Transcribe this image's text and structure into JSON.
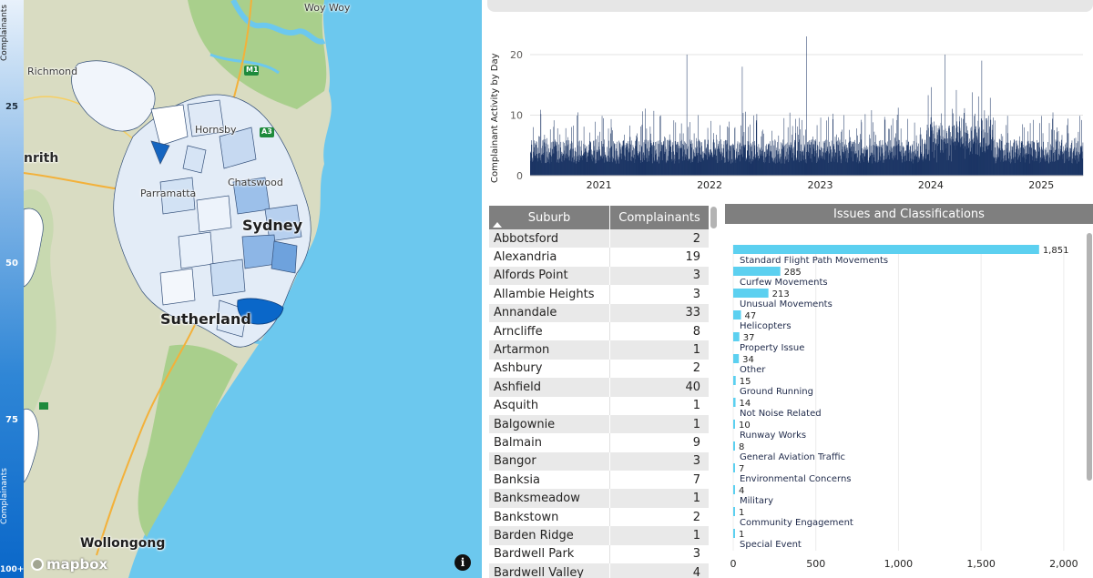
{
  "legend": {
    "title_top": "Complainants",
    "title_bottom": "Complainants",
    "ticks": [
      "25",
      "50",
      "75",
      "100+"
    ]
  },
  "map": {
    "labels": {
      "woy_woy": "Woy Woy",
      "richmond": "Richmond",
      "penrith": "nrith",
      "hornsby": "Hornsby",
      "parramatta": "Parramatta",
      "chatswood": "Chatswood",
      "sydney": "Sydney",
      "sutherland": "Sutherland",
      "wollongong": "Wollongong",
      "m1": "M1",
      "a3": "A3"
    },
    "attribution": "mapbox",
    "info_icon": "info-icon",
    "colors": {
      "water": "#6cc8ee",
      "land": "#d9dcc2",
      "bush": "#a9cf8c",
      "suburb_high": "#0a67c9"
    }
  },
  "activity_chart": {
    "ylabel": "Complainant Activity by Day"
  },
  "suburb_table": {
    "columns": [
      "Suburb",
      "Complainants"
    ],
    "sort": "ascending",
    "rows": [
      {
        "suburb": "Abbotsford",
        "count": "2"
      },
      {
        "suburb": "Alexandria",
        "count": "19"
      },
      {
        "suburb": "Alfords Point",
        "count": "3"
      },
      {
        "suburb": "Allambie Heights",
        "count": "3"
      },
      {
        "suburb": "Annandale",
        "count": "33"
      },
      {
        "suburb": "Arncliffe",
        "count": "8"
      },
      {
        "suburb": "Artarmon",
        "count": "1"
      },
      {
        "suburb": "Ashbury",
        "count": "2"
      },
      {
        "suburb": "Ashfield",
        "count": "40"
      },
      {
        "suburb": "Asquith",
        "count": "1"
      },
      {
        "suburb": "Balgownie",
        "count": "1"
      },
      {
        "suburb": "Balmain",
        "count": "9"
      },
      {
        "suburb": "Bangor",
        "count": "3"
      },
      {
        "suburb": "Banksia",
        "count": "7"
      },
      {
        "suburb": "Banksmeadow",
        "count": "1"
      },
      {
        "suburb": "Bankstown",
        "count": "2"
      },
      {
        "suburb": "Barden Ridge",
        "count": "1"
      },
      {
        "suburb": "Bardwell Park",
        "count": "3"
      },
      {
        "suburb": "Bardwell Valley",
        "count": "4"
      }
    ]
  },
  "issues_chart": {
    "title": "Issues and Classifications"
  },
  "chart_data": [
    {
      "type": "bar",
      "ylabel": "Complainant Activity by Day",
      "xlabel": "",
      "x_ticks": [
        "2021",
        "2022",
        "2023",
        "2024",
        "2025"
      ],
      "y_ticks": [
        0,
        10,
        20
      ],
      "ylim": [
        0,
        23
      ],
      "x_range": [
        "2020-05",
        "2025-05"
      ],
      "peaks": [
        {
          "x": "2021-11",
          "y": 20
        },
        {
          "x": "2022-05",
          "y": 18
        },
        {
          "x": "2022-12",
          "y": 23
        },
        {
          "x": "2024-03",
          "y": 20
        },
        {
          "x": "2024-07",
          "y": 19
        }
      ],
      "grid": true,
      "color": "#0f2a5c"
    },
    {
      "type": "bar",
      "orientation": "horizontal",
      "categories": [
        "Standard Flight Path Movements",
        "Curfew Movements",
        "Unusual Movements",
        "Helicopters",
        "Property Issue",
        "Other",
        "Ground Running",
        "Not Noise Related",
        "Runway Works",
        "General Aviation Traffic",
        "Environmental Concerns",
        "Military",
        "Community Engagement",
        "Special Event"
      ],
      "values": [
        1851,
        285,
        213,
        47,
        37,
        34,
        15,
        14,
        10,
        8,
        7,
        4,
        1,
        1
      ],
      "value_labels": [
        "1,851",
        "285",
        "213",
        "47",
        "37",
        "34",
        "15",
        "14",
        "10",
        "8",
        "7",
        "4",
        "1",
        "1"
      ],
      "x_ticks": [
        "0",
        "500",
        "1,000",
        "1,500",
        "2,000"
      ],
      "xlim": [
        0,
        2100
      ],
      "grid": true,
      "color": "#5cd0f0"
    }
  ]
}
